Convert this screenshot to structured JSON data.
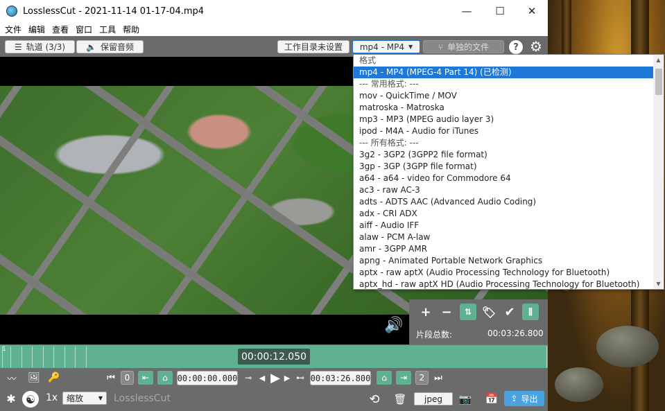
{
  "window": {
    "title": "LosslessCut - 2021-11-14 01-17-04.mp4",
    "controls": {
      "minimize": "—",
      "maximize": "☐",
      "close": "✕"
    }
  },
  "menu": [
    "文件",
    "编辑",
    "查看",
    "窗口",
    "工具",
    "帮助"
  ],
  "toolbar": {
    "tracks_label": "轨道 (3/3)",
    "keep_audio_label": "保留音频",
    "workdir_label": "工作目录未设置",
    "format_label": "mp4 - MP4",
    "separate_files_label": "单独的文件",
    "help_label": "?"
  },
  "format_options": [
    {
      "label": "格式",
      "kind": "header"
    },
    {
      "label": "mp4 - MP4 (MPEG-4 Part 14)   (已检测)",
      "kind": "selected"
    },
    {
      "label": "--- 常用格式:   ---",
      "kind": "header"
    },
    {
      "label": "mov - QuickTime / MOV",
      "kind": "option"
    },
    {
      "label": "matroska - Matroska",
      "kind": "option"
    },
    {
      "label": "mp3 - MP3 (MPEG audio layer 3)",
      "kind": "option"
    },
    {
      "label": "ipod - M4A - Audio for iTunes",
      "kind": "option"
    },
    {
      "label": "--- 所有格式:   ---",
      "kind": "header"
    },
    {
      "label": "3g2 - 3GP2 (3GPP2 file format)",
      "kind": "option"
    },
    {
      "label": "3gp - 3GP (3GPP file format)",
      "kind": "option"
    },
    {
      "label": "a64 - a64 - video for Commodore 64",
      "kind": "option"
    },
    {
      "label": "ac3 - raw AC-3",
      "kind": "option"
    },
    {
      "label": "adts - ADTS AAC (Advanced Audio Coding)",
      "kind": "option"
    },
    {
      "label": "adx - CRI ADX",
      "kind": "option"
    },
    {
      "label": "aiff - Audio IFF",
      "kind": "option"
    },
    {
      "label": "alaw - PCM A-law",
      "kind": "option"
    },
    {
      "label": "amr - 3GPP AMR",
      "kind": "option"
    },
    {
      "label": "apng - Animated Portable Network Graphics",
      "kind": "option"
    },
    {
      "label": "aptx - raw aptX (Audio Processing Technology for Bluetooth)",
      "kind": "option"
    },
    {
      "label": "aptx_hd - raw aptX HD (Audio Processing Technology for Bluetooth)",
      "kind": "option"
    }
  ],
  "segments": {
    "total_label": "片段总数:",
    "total_value": "00:03:26.800",
    "start_index": "1"
  },
  "timeline": {
    "current_time": "00:00:12.050"
  },
  "controls": {
    "segment_start_num": "0",
    "segment_end_num": "2",
    "start_time": "00:00:00.000",
    "end_time": "00:03:26.800",
    "speed": "1x",
    "zoom_label": "缩放",
    "app_name": "LosslessCut",
    "capture_format": "jpeg",
    "export_label": "导出"
  },
  "colors": {
    "accent": "#5fb192",
    "selection": "#1e78d8",
    "chrome": "#6b6b6b"
  }
}
